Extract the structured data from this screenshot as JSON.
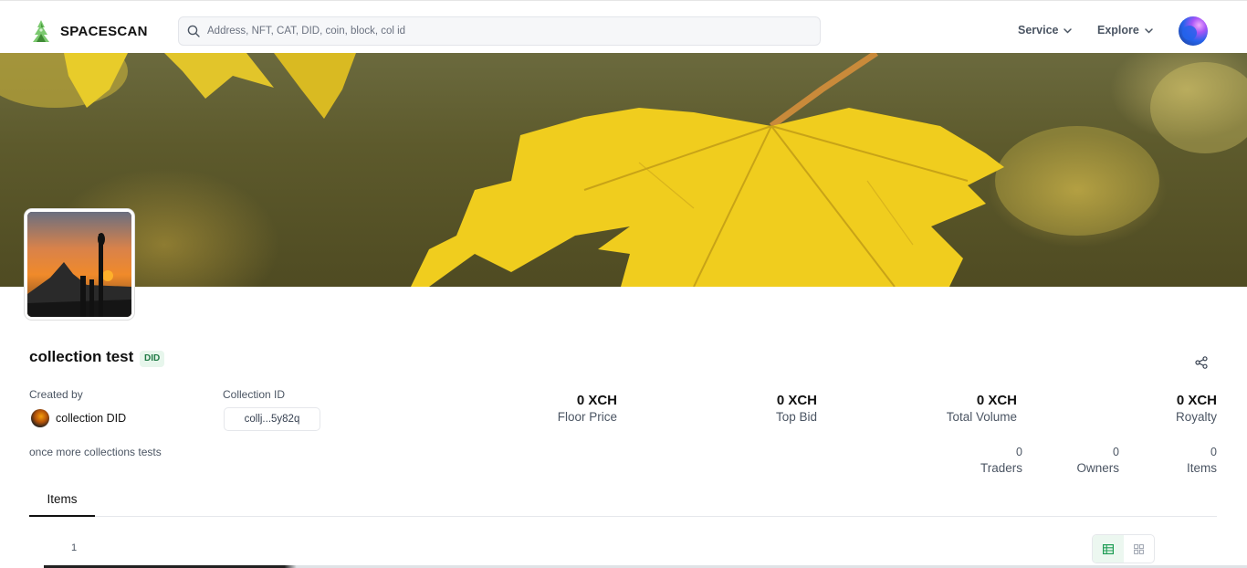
{
  "app": {
    "brand": "SPACESCAN"
  },
  "search": {
    "placeholder": "Address, NFT, CAT, DID, coin, block, col id"
  },
  "nav": {
    "service_label": "Service",
    "explore_label": "Explore"
  },
  "collection": {
    "title": "collection test",
    "badge": "DID",
    "created_by_label": "Created by",
    "creator_name": "collection DID",
    "collection_id_label": "Collection ID",
    "collection_id_value": "collj...5y82q",
    "description": "once more collections tests"
  },
  "stats": [
    {
      "value": "0 XCH",
      "label": "Floor Price"
    },
    {
      "value": "0 XCH",
      "label": "Top Bid"
    },
    {
      "value": "0 XCH",
      "label": "Total Volume"
    },
    {
      "value": "0 XCH",
      "label": "Royalty"
    }
  ],
  "counts": [
    {
      "value": "0",
      "label": "Traders"
    },
    {
      "value": "0",
      "label": "Owners"
    },
    {
      "value": "0",
      "label": "Items"
    }
  ],
  "tabs": [
    {
      "label": "Items"
    }
  ],
  "pagination": {
    "current_page": "1"
  },
  "colors": {
    "accent_green": "#1f7a45",
    "badge_bg": "#e7f6ec",
    "text_primary": "#111111",
    "text_secondary": "#4b5563"
  },
  "icons": {
    "logo": "spacescan-logo-icon",
    "search": "search-icon",
    "chevron": "chevron-down-icon",
    "share": "share-icon",
    "table_view": "table-view-icon",
    "grid_view": "grid-view-icon"
  }
}
